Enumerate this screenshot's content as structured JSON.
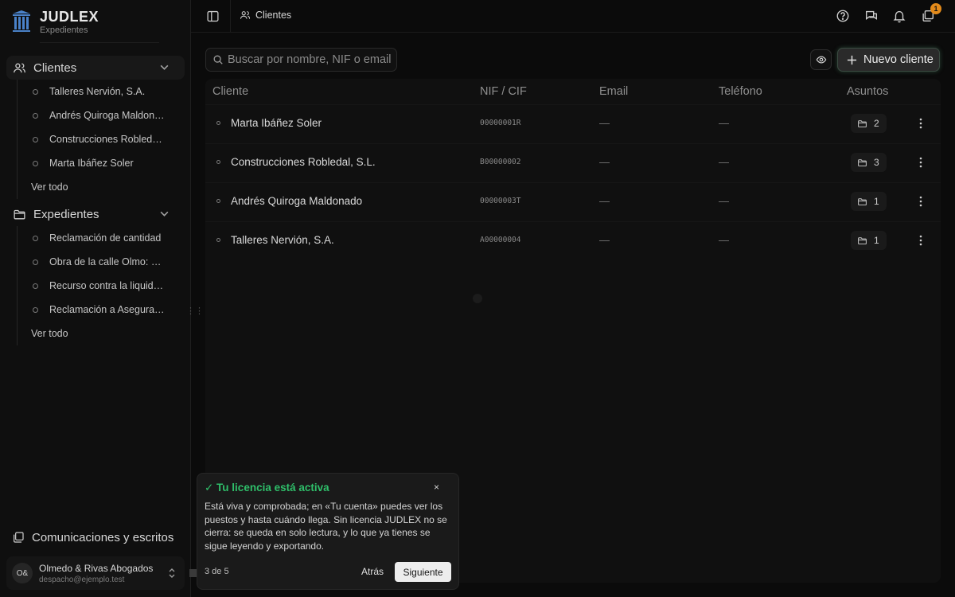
{
  "brand": {
    "name": "JUDLEX",
    "subtitle": "Expedientes"
  },
  "sidebar": {
    "clients": {
      "label": "Clientes",
      "items": [
        "Talleres Nervión, S.A.",
        "Andrés Quiroga Maldonado",
        "Construcciones Robledal, S.L.",
        "Marta Ibáñez Soler"
      ],
      "see_all": "Ver todo"
    },
    "cases": {
      "label": "Expedientes",
      "items": [
        "Reclamación de cantidad",
        "Obra de la calle Olmo: vicios",
        "Recurso contra la liquidación",
        "Reclamación a Aseguradora"
      ],
      "see_all": "Ver todo"
    },
    "communications": "Comunicaciones y escritos",
    "account": {
      "initials": "O&",
      "name": "Olmedo & Rivas Abogados",
      "email": "despacho@ejemplo.test"
    }
  },
  "topbar": {
    "breadcrumb": "Clientes",
    "inbox_badge": "1"
  },
  "toolbar": {
    "search_placeholder": "Buscar por nombre, NIF o email.",
    "new_client": "Nuevo cliente"
  },
  "table": {
    "headers": {
      "client": "Cliente",
      "nif": "NIF / CIF",
      "email": "Email",
      "phone": "Teléfono",
      "cases": "Asuntos"
    },
    "rows": [
      {
        "name": "Marta Ibáñez Soler",
        "nif": "00000001R",
        "email": "—",
        "phone": "—",
        "cases": "2"
      },
      {
        "name": "Construcciones Robledal, S.L.",
        "nif": "B00000002",
        "email": "—",
        "phone": "—",
        "cases": "3"
      },
      {
        "name": "Andrés Quiroga Maldonado",
        "nif": "00000003T",
        "email": "—",
        "phone": "—",
        "cases": "1"
      },
      {
        "name": "Talleres Nervión, S.A.",
        "nif": "A00000004",
        "email": "—",
        "phone": "—",
        "cases": "1"
      }
    ]
  },
  "tour": {
    "title": "✓ Tu licencia está activa",
    "close": "×",
    "body": "Está viva y comprobada; en «Tu cuenta» puedes ver los puestos y hasta cuándo llega. Sin licencia JUDLEX no se cierra: se queda en solo lectura, y lo que ya tienes se sigue leyendo y exportando.",
    "step": "3 de 5",
    "back": "Atrás",
    "next": "Siguiente"
  },
  "colors": {
    "accent_success": "#2fbf6a",
    "badge": "#e38a1a",
    "logo": "#4a82c9"
  }
}
